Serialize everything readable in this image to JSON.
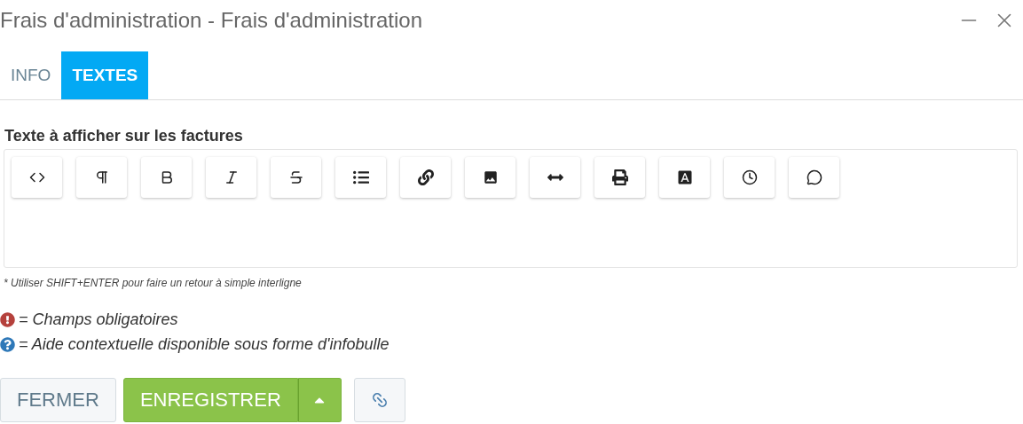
{
  "window": {
    "title": "Frais d'administration - Frais d'administration"
  },
  "tabs": [
    {
      "label": "INFO",
      "selected": false
    },
    {
      "label": "TEXTES",
      "selected": true
    }
  ],
  "editor": {
    "label": "Texte à afficher sur les factures",
    "tools": [
      {
        "kind": "code"
      },
      {
        "kind": "paragraph"
      },
      {
        "kind": "bold"
      },
      {
        "kind": "italic"
      },
      {
        "kind": "strike"
      },
      {
        "kind": "list"
      },
      {
        "kind": "link"
      },
      {
        "kind": "image"
      },
      {
        "kind": "rule"
      },
      {
        "kind": "print"
      },
      {
        "kind": "font"
      },
      {
        "kind": "clock"
      },
      {
        "kind": "comment"
      }
    ],
    "hint": "* Utiliser SHIFT+ENTER pour faire un retour à simple interligne"
  },
  "legend": [
    {
      "kind": "required",
      "text": "= Champs obligatoires"
    },
    {
      "kind": "help",
      "text": "= Aide contextuelle disponible sous forme d'infobulle"
    }
  ],
  "buttons": {
    "close": "FERMER",
    "save": "ENREGISTRER"
  }
}
